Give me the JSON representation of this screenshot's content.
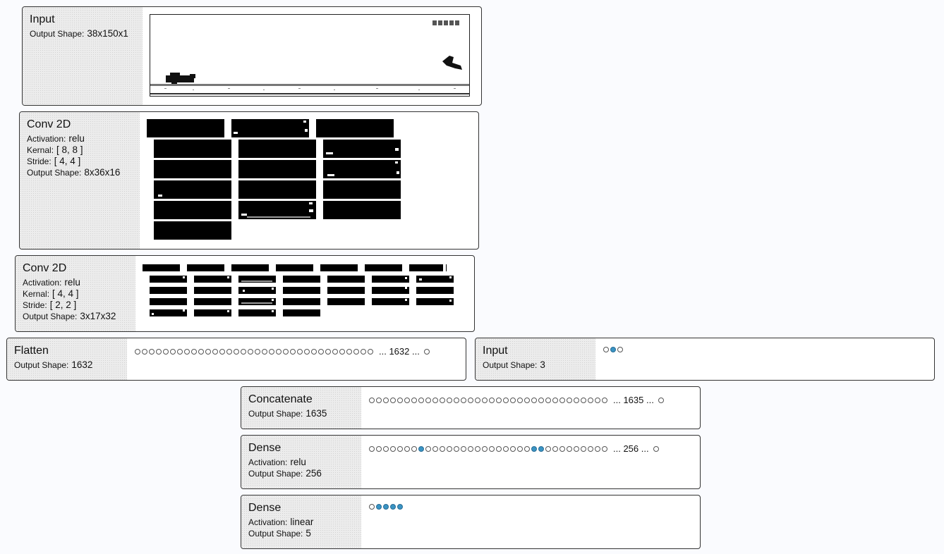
{
  "layers": {
    "input_image": {
      "title": "Input",
      "props": [
        {
          "label": "Output Shape:",
          "value": "38x150x1"
        }
      ]
    },
    "conv1": {
      "title": "Conv 2D",
      "props": [
        {
          "label": "Activation:",
          "value": "relu"
        },
        {
          "label": "Kernal:",
          "value": "[ 8, 8 ]"
        },
        {
          "label": "Stride:",
          "value": "[ 4, 4 ]"
        },
        {
          "label": "Output Shape:",
          "value": "8x36x16"
        }
      ],
      "feature_maps": 16
    },
    "conv2": {
      "title": "Conv 2D",
      "props": [
        {
          "label": "Activation:",
          "value": "relu"
        },
        {
          "label": "Kernal:",
          "value": "[ 4, 4 ]"
        },
        {
          "label": "Stride:",
          "value": "[ 2, 2 ]"
        },
        {
          "label": "Output Shape:",
          "value": "3x17x32"
        }
      ],
      "feature_maps": 32
    },
    "flatten": {
      "title": "Flatten",
      "props": [
        {
          "label": "Output Shape:",
          "value": "1632"
        }
      ],
      "nodes": {
        "shown": 34,
        "active": [],
        "ellipsis": "... 1632 ..."
      }
    },
    "input_vec": {
      "title": "Input",
      "props": [
        {
          "label": "Output Shape:",
          "value": "3"
        }
      ],
      "nodes": {
        "shown": 3,
        "active": [
          1
        ]
      }
    },
    "concat": {
      "title": "Concatenate",
      "props": [
        {
          "label": "Output Shape:",
          "value": "1635"
        }
      ],
      "nodes": {
        "shown": 34,
        "active": [],
        "ellipsis": "... 1635 ..."
      }
    },
    "dense1": {
      "title": "Dense",
      "props": [
        {
          "label": "Activation:",
          "value": "relu"
        },
        {
          "label": "Output Shape:",
          "value": "256"
        }
      ],
      "nodes": {
        "shown": 34,
        "active": [
          7,
          23,
          24
        ],
        "ellipsis": "... 256 ..."
      }
    },
    "dense2": {
      "title": "Dense",
      "props": [
        {
          "label": "Activation:",
          "value": "linear"
        },
        {
          "label": "Output Shape:",
          "value": "5"
        }
      ],
      "nodes": {
        "shown": 5,
        "active": [
          1,
          2,
          3,
          4
        ]
      }
    }
  },
  "colors": {
    "active_node": "#3a94c4",
    "background": "#fafbfe",
    "feature_map": "#000000"
  }
}
